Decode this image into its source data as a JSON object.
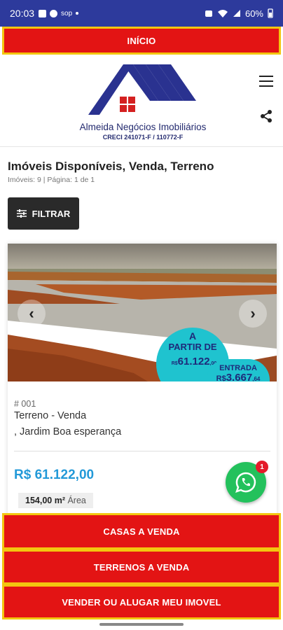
{
  "status_bar": {
    "time": "20:03",
    "left_icons": [
      "gallery-icon",
      "facebook-icon",
      "app-icon",
      "dot"
    ],
    "app_label": "sop",
    "battery": "60%"
  },
  "top_button": {
    "label": "INÍCIO"
  },
  "brand": {
    "name": "Almeida Negócios Imobiliários",
    "creci": "CRECI 241071-F / 110772-F"
  },
  "listing": {
    "title": "Imóveis Disponíveis, Venda, Terreno",
    "summary": "Imóveis: 9 | Página: 1 de 1",
    "filter_label": "FILTRAR"
  },
  "property": {
    "promo": {
      "line1": "A",
      "line2": "PARTIR DE",
      "price_prefix": "R$",
      "price": "61.122",
      "price_cents": ",00",
      "entry_label": "ENTRADA",
      "entry_prefix": "R$",
      "entry_value": "3.667",
      "entry_cents": ",64"
    },
    "code": "# 001",
    "type": "Terreno - Venda",
    "address": ", Jardim Boa esperança",
    "price": "R$ 61.122,00",
    "area_value": "154,00 m²",
    "area_label": "Área"
  },
  "whatsapp": {
    "badge": "1"
  },
  "bottom_buttons": {
    "casas": "CASAS A VENDA",
    "terrenos": "TERRENOS A VENDA",
    "vender": "VENDER OU ALUGAR MEU IMOVEL"
  },
  "colors": {
    "status_bar": "#2d3a9c",
    "button_red": "#e31414",
    "button_border": "#f3c60f",
    "price_blue": "#2299d8",
    "whatsapp_green": "#23c15c",
    "logo_blue": "#22296e"
  }
}
